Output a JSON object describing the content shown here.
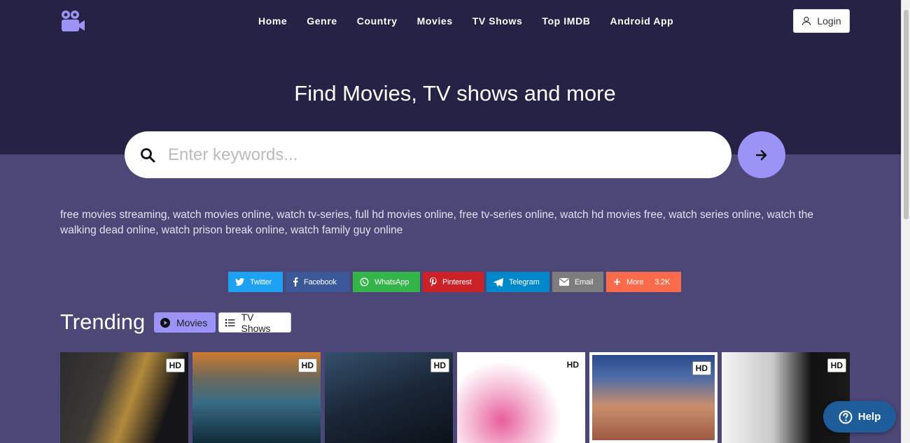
{
  "nav": {
    "items": [
      "Home",
      "Genre",
      "Country",
      "Movies",
      "TV Shows",
      "Top IMDB",
      "Android App"
    ],
    "login_label": "Login"
  },
  "hero": {
    "title": "Find Movies, TV shows and more",
    "search_placeholder": "Enter keywords..."
  },
  "seo_text": "free movies streaming, watch movies online, watch tv-series, full hd movies online, free tv-series online, watch hd movies free, watch series online, watch the walking dead online, watch prison break online, watch family guy online",
  "share": [
    {
      "label": "Twitter",
      "color": "#1da1f2",
      "icon": "twitter-icon"
    },
    {
      "label": "Facebook",
      "color": "#3b5998",
      "icon": "facebook-icon"
    },
    {
      "label": "WhatsApp",
      "color": "#34b54a",
      "icon": "whatsapp-icon"
    },
    {
      "label": "Pinterest",
      "color": "#cb2127",
      "icon": "pinterest-icon"
    },
    {
      "label": "Telegram",
      "color": "#0088cc",
      "icon": "telegram-icon"
    },
    {
      "label": "Email",
      "color": "#7d7d7d",
      "icon": "email-icon"
    },
    {
      "label": "More",
      "color": "#fa6b4b",
      "icon": "plus-icon",
      "count": "3.2K"
    }
  ],
  "trending": {
    "title": "Trending",
    "tabs": [
      {
        "label": "Movies",
        "icon": "play-circle-icon",
        "active": true
      },
      {
        "label": "TV Shows",
        "icon": "list-icon",
        "active": false
      }
    ],
    "posters": [
      {
        "badge": "HD",
        "colors": [
          "#2b2a2e",
          "#b38a3c",
          "#151417"
        ]
      },
      {
        "badge": "HD",
        "colors": [
          "#d07a2e",
          "#3a6c86",
          "#0f2b3a"
        ]
      },
      {
        "badge": "HD",
        "colors": [
          "#35506c",
          "#1b2738",
          "#0b1119"
        ]
      },
      {
        "badge": "HD",
        "colors": [
          "#ffffff",
          "#f4b6d1",
          "#e85d9c"
        ]
      },
      {
        "badge": "HD",
        "colors": [
          "#2c4a8a",
          "#c98e6d",
          "#9d5a43"
        ]
      },
      {
        "badge": "HD",
        "colors": [
          "#f5f5f5",
          "#c9c9c9",
          "#111111"
        ]
      }
    ]
  },
  "help": {
    "label": "Help"
  },
  "colors": {
    "header_bg": "#252245",
    "page_bg": "#4c4776",
    "accent": "#9b93f6",
    "help_button": "#1f5d9a"
  }
}
